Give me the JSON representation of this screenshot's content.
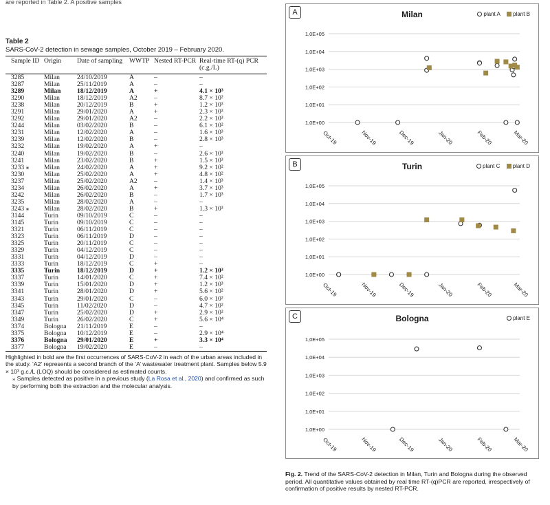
{
  "top_fragment": "are reported in Table 2. A positive samples",
  "table": {
    "label": "Table 2",
    "caption": "SARS-CoV-2 detection in sewage samples, October 2019 – February 2020.",
    "headers": [
      "Sample ID",
      "Origin",
      "Date of sampling",
      "WWTP",
      "Nested RT-PCR",
      "Real-time RT-(q) PCR (c.g./L)"
    ],
    "rows": [
      {
        "id": "3285",
        "origin": "Milan",
        "date": "24/10/2019",
        "wwtp": "A",
        "nested": "–",
        "qpcr": "–",
        "bold": false
      },
      {
        "id": "3287",
        "origin": "Milan",
        "date": "25/11/2019",
        "wwtp": "A",
        "nested": "–",
        "qpcr": "–",
        "bold": false
      },
      {
        "id": "3289",
        "origin": "Milan",
        "date": "18/12/2019",
        "wwtp": "A",
        "nested": "+",
        "qpcr": "4.1 × 10³",
        "bold": true
      },
      {
        "id": "3290",
        "origin": "Milan",
        "date": "18/12/2019",
        "wwtp": "A2",
        "nested": "–",
        "qpcr": "8.7 × 10²",
        "bold": false
      },
      {
        "id": "3238",
        "origin": "Milan",
        "date": "20/12/2019",
        "wwtp": "B",
        "nested": "+",
        "qpcr": "1.2 × 10³",
        "bold": false
      },
      {
        "id": "3291",
        "origin": "Milan",
        "date": "29/01/2020",
        "wwtp": "A",
        "nested": "+",
        "qpcr": "2.3 × 10³",
        "bold": false
      },
      {
        "id": "3292",
        "origin": "Milan",
        "date": "29/01/2020",
        "wwtp": "A2",
        "nested": "–",
        "qpcr": "2.2 × 10³",
        "bold": false
      },
      {
        "id": "3244",
        "origin": "Milan",
        "date": "03/02/2020",
        "wwtp": "B",
        "nested": "–",
        "qpcr": "6.1 × 10²",
        "bold": false
      },
      {
        "id": "3231",
        "origin": "Milan",
        "date": "12/02/2020",
        "wwtp": "A",
        "nested": "–",
        "qpcr": "1.6 × 10³",
        "bold": false
      },
      {
        "id": "3239",
        "origin": "Milan",
        "date": "12/02/2020",
        "wwtp": "B",
        "nested": "–",
        "qpcr": "2.8 × 10³",
        "bold": false
      },
      {
        "id": "3232",
        "origin": "Milan",
        "date": "19/02/2020",
        "wwtp": "A",
        "nested": "+",
        "qpcr": "–",
        "bold": false
      },
      {
        "id": "3240",
        "origin": "Milan",
        "date": "19/02/2020",
        "wwtp": "B",
        "nested": "–",
        "qpcr": "2.6 × 10³",
        "bold": false
      },
      {
        "id": "3241",
        "origin": "Milan",
        "date": "23/02/2020",
        "wwtp": "B",
        "nested": "+",
        "qpcr": "1.5 × 10³",
        "bold": false
      },
      {
        "id": "3233 ⁎",
        "origin": "Milan",
        "date": "24/02/2020",
        "wwtp": "A",
        "nested": "+",
        "qpcr": "9.2 × 10²",
        "bold": false
      },
      {
        "id": "3230",
        "origin": "Milan",
        "date": "25/02/2020",
        "wwtp": "A",
        "nested": "+",
        "qpcr": "4.8 × 10²",
        "bold": false
      },
      {
        "id": "3237",
        "origin": "Milan",
        "date": "25/02/2020",
        "wwtp": "A2",
        "nested": "–",
        "qpcr": "1.4 × 10³",
        "bold": false
      },
      {
        "id": "3234",
        "origin": "Milan",
        "date": "26/02/2020",
        "wwtp": "A",
        "nested": "+",
        "qpcr": "3.7 × 10³",
        "bold": false
      },
      {
        "id": "3242",
        "origin": "Milan",
        "date": "26/02/2020",
        "wwtp": "B",
        "nested": "–",
        "qpcr": "1.7 × 10³",
        "bold": false
      },
      {
        "id": "3235",
        "origin": "Milan",
        "date": "28/02/2020",
        "wwtp": "A",
        "nested": "–",
        "qpcr": "–",
        "bold": false
      },
      {
        "id": "3243 ⁎",
        "origin": "Milan",
        "date": "28/02/2020",
        "wwtp": "B",
        "nested": "+",
        "qpcr": "1.3 × 10³",
        "bold": false
      },
      {
        "id": "3144",
        "origin": "Turin",
        "date": "09/10/2019",
        "wwtp": "C",
        "nested": "–",
        "qpcr": "–",
        "bold": false
      },
      {
        "id": "3145",
        "origin": "Turin",
        "date": "09/10/2019",
        "wwtp": "C",
        "nested": "–",
        "qpcr": "–",
        "bold": false
      },
      {
        "id": "3321",
        "origin": "Turin",
        "date": "06/11/2019",
        "wwtp": "C",
        "nested": "–",
        "qpcr": "–",
        "bold": false
      },
      {
        "id": "3323",
        "origin": "Turin",
        "date": "06/11/2019",
        "wwtp": "D",
        "nested": "–",
        "qpcr": "–",
        "bold": false
      },
      {
        "id": "3325",
        "origin": "Turin",
        "date": "20/11/2019",
        "wwtp": "C",
        "nested": "–",
        "qpcr": "–",
        "bold": false
      },
      {
        "id": "3329",
        "origin": "Turin",
        "date": "04/12/2019",
        "wwtp": "C",
        "nested": "–",
        "qpcr": "–",
        "bold": false
      },
      {
        "id": "3331",
        "origin": "Turin",
        "date": "04/12/2019",
        "wwtp": "D",
        "nested": "–",
        "qpcr": "–",
        "bold": false
      },
      {
        "id": "3333",
        "origin": "Turin",
        "date": "18/12/2019",
        "wwtp": "C",
        "nested": "+",
        "qpcr": "–",
        "bold": false
      },
      {
        "id": "3335",
        "origin": "Turin",
        "date": "18/12/2019",
        "wwtp": "D",
        "nested": "+",
        "qpcr": "1.2 × 10³",
        "bold": true
      },
      {
        "id": "3337",
        "origin": "Turin",
        "date": "14/01/2020",
        "wwtp": "C",
        "nested": "+",
        "qpcr": "7.4 × 10²",
        "bold": false
      },
      {
        "id": "3339",
        "origin": "Turin",
        "date": "15/01/2020",
        "wwtp": "D",
        "nested": "+",
        "qpcr": "1.2 × 10³",
        "bold": false
      },
      {
        "id": "3341",
        "origin": "Turin",
        "date": "28/01/2020",
        "wwtp": "D",
        "nested": "+",
        "qpcr": "5.6 × 10²",
        "bold": false
      },
      {
        "id": "3343",
        "origin": "Turin",
        "date": "29/01/2020",
        "wwtp": "C",
        "nested": "–",
        "qpcr": "6.0 × 10²",
        "bold": false
      },
      {
        "id": "3345",
        "origin": "Turin",
        "date": "11/02/2020",
        "wwtp": "D",
        "nested": "–",
        "qpcr": "4.7 × 10²",
        "bold": false
      },
      {
        "id": "3347",
        "origin": "Turin",
        "date": "25/02/2020",
        "wwtp": "D",
        "nested": "+",
        "qpcr": "2.9 × 10²",
        "bold": false
      },
      {
        "id": "3349",
        "origin": "Turin",
        "date": "26/02/2020",
        "wwtp": "C",
        "nested": "+",
        "qpcr": "5.6 × 10⁴",
        "bold": false
      },
      {
        "id": "3374",
        "origin": "Bologna",
        "date": "21/11/2019",
        "wwtp": "E",
        "nested": "–",
        "qpcr": "–",
        "bold": false
      },
      {
        "id": "3375",
        "origin": "Bologna",
        "date": "10/12/2019",
        "wwtp": "E",
        "nested": "–",
        "qpcr": "2.9 × 10⁴",
        "bold": false
      },
      {
        "id": "3376",
        "origin": "Bologna",
        "date": "29/01/2020",
        "wwtp": "E",
        "nested": "+",
        "qpcr": "3.3 × 10⁴",
        "bold": true
      },
      {
        "id": "3377",
        "origin": "Bologna",
        "date": "19/02/2020",
        "wwtp": "E",
        "nested": "–",
        "qpcr": "–",
        "bold": false
      }
    ],
    "footnote_main": "Highlighted in bold are the first occurrences of SARS-CoV-2 in each of the urban areas included in the study. ‘A2’ represents a second branch of the ‘A’ wastewater treatment plant. Samples below 5.9 × 10³ g.c./L (LOQ) should be considered as estimated counts.",
    "footnote_star_pre": "⁎  Samples detected as positive in a previous study (",
    "footnote_star_link": "La Rosa et al., 2020",
    "footnote_star_post": ") and confirmed as such by performing both the extraction and the molecular analysis."
  },
  "figure": {
    "caption_label": "Fig. 2.",
    "caption_text": "Trend of the SARS-CoV-2 detection in Milan, Turin and Bologna during the observed period. All quantitative values obtained by real time RT-(q)PCR are reported, irrespectively of confirmation of positive results by nested RT-PCR.",
    "colors": {
      "open_marker": "#333333",
      "square_marker": "#a08a48"
    }
  },
  "chart_data": [
    {
      "type": "scatter",
      "panel": "A",
      "title": "Milan",
      "yscale": "log",
      "ytick_labels": [
        "1,0E+00",
        "1,0E+01",
        "1,0E+02",
        "1,0E+03",
        "1,0E+04",
        "1,0E+05"
      ],
      "xtick_labels": [
        "Oct-19",
        "Nov-19",
        "Dec-19",
        "Jan-20",
        "Feb-20",
        "Mar-20"
      ],
      "grid": true,
      "series": [
        {
          "name": "plant A",
          "marker": "open-circle",
          "points": [
            {
              "x": "2019-10-24",
              "y": 1
            },
            {
              "x": "2019-11-25",
              "y": 1
            },
            {
              "x": "2019-12-18",
              "y": 4100
            },
            {
              "x": "2019-12-18",
              "y": 870
            },
            {
              "x": "2020-01-29",
              "y": 2300
            },
            {
              "x": "2020-01-29",
              "y": 2200
            },
            {
              "x": "2020-02-12",
              "y": 1600
            },
            {
              "x": "2020-02-19",
              "y": 1
            },
            {
              "x": "2020-02-24",
              "y": 920
            },
            {
              "x": "2020-02-25",
              "y": 480
            },
            {
              "x": "2020-02-25",
              "y": 1400
            },
            {
              "x": "2020-02-26",
              "y": 3700
            },
            {
              "x": "2020-02-28",
              "y": 1
            }
          ]
        },
        {
          "name": "plant B",
          "marker": "square",
          "points": [
            {
              "x": "2019-12-20",
              "y": 1200
            },
            {
              "x": "2020-02-03",
              "y": 610
            },
            {
              "x": "2020-02-12",
              "y": 2800
            },
            {
              "x": "2020-02-19",
              "y": 2600
            },
            {
              "x": "2020-02-23",
              "y": 1500
            },
            {
              "x": "2020-02-26",
              "y": 1700
            },
            {
              "x": "2020-02-28",
              "y": 1300
            }
          ]
        }
      ]
    },
    {
      "type": "scatter",
      "panel": "B",
      "title": "Turin",
      "yscale": "log",
      "ytick_labels": [
        "1,0E+00",
        "1,0E+01",
        "1,0E+02",
        "1,0E+03",
        "1,0E+04",
        "1,0E+05"
      ],
      "xtick_labels": [
        "Oct-19",
        "Nov-19",
        "Dec-19",
        "Jan-20",
        "Feb-20",
        "Mar-20"
      ],
      "grid": true,
      "series": [
        {
          "name": "plant C",
          "marker": "open-circle",
          "points": [
            {
              "x": "2019-10-09",
              "y": 1
            },
            {
              "x": "2019-10-09",
              "y": 1
            },
            {
              "x": "2019-11-06",
              "y": 1
            },
            {
              "x": "2019-11-20",
              "y": 1
            },
            {
              "x": "2019-12-04",
              "y": 1
            },
            {
              "x": "2019-12-18",
              "y": 1
            },
            {
              "x": "2020-01-14",
              "y": 740
            },
            {
              "x": "2020-01-29",
              "y": 600
            },
            {
              "x": "2020-02-26",
              "y": 56000
            }
          ]
        },
        {
          "name": "plant D",
          "marker": "square",
          "points": [
            {
              "x": "2019-11-06",
              "y": 1
            },
            {
              "x": "2019-12-04",
              "y": 1
            },
            {
              "x": "2019-12-18",
              "y": 1200
            },
            {
              "x": "2020-01-15",
              "y": 1200
            },
            {
              "x": "2020-01-28",
              "y": 560
            },
            {
              "x": "2020-02-11",
              "y": 470
            },
            {
              "x": "2020-02-25",
              "y": 290
            }
          ]
        }
      ]
    },
    {
      "type": "scatter",
      "panel": "C",
      "title": "Bologna",
      "yscale": "log",
      "ytick_labels": [
        "1,0E+00",
        "1,0E+01",
        "1,0E+02",
        "1,0E+03",
        "1,0E+04",
        "1,0E+05"
      ],
      "xtick_labels": [
        "Oct-19",
        "Nov-19",
        "Dec-19",
        "Jan-20",
        "Feb-20",
        "Mar-20"
      ],
      "grid": true,
      "series": [
        {
          "name": "plant E",
          "marker": "open-circle",
          "points": [
            {
              "x": "2019-11-21",
              "y": 1
            },
            {
              "x": "2019-12-10",
              "y": 29000
            },
            {
              "x": "2020-01-29",
              "y": 33000
            },
            {
              "x": "2020-02-19",
              "y": 1
            }
          ]
        }
      ]
    }
  ]
}
